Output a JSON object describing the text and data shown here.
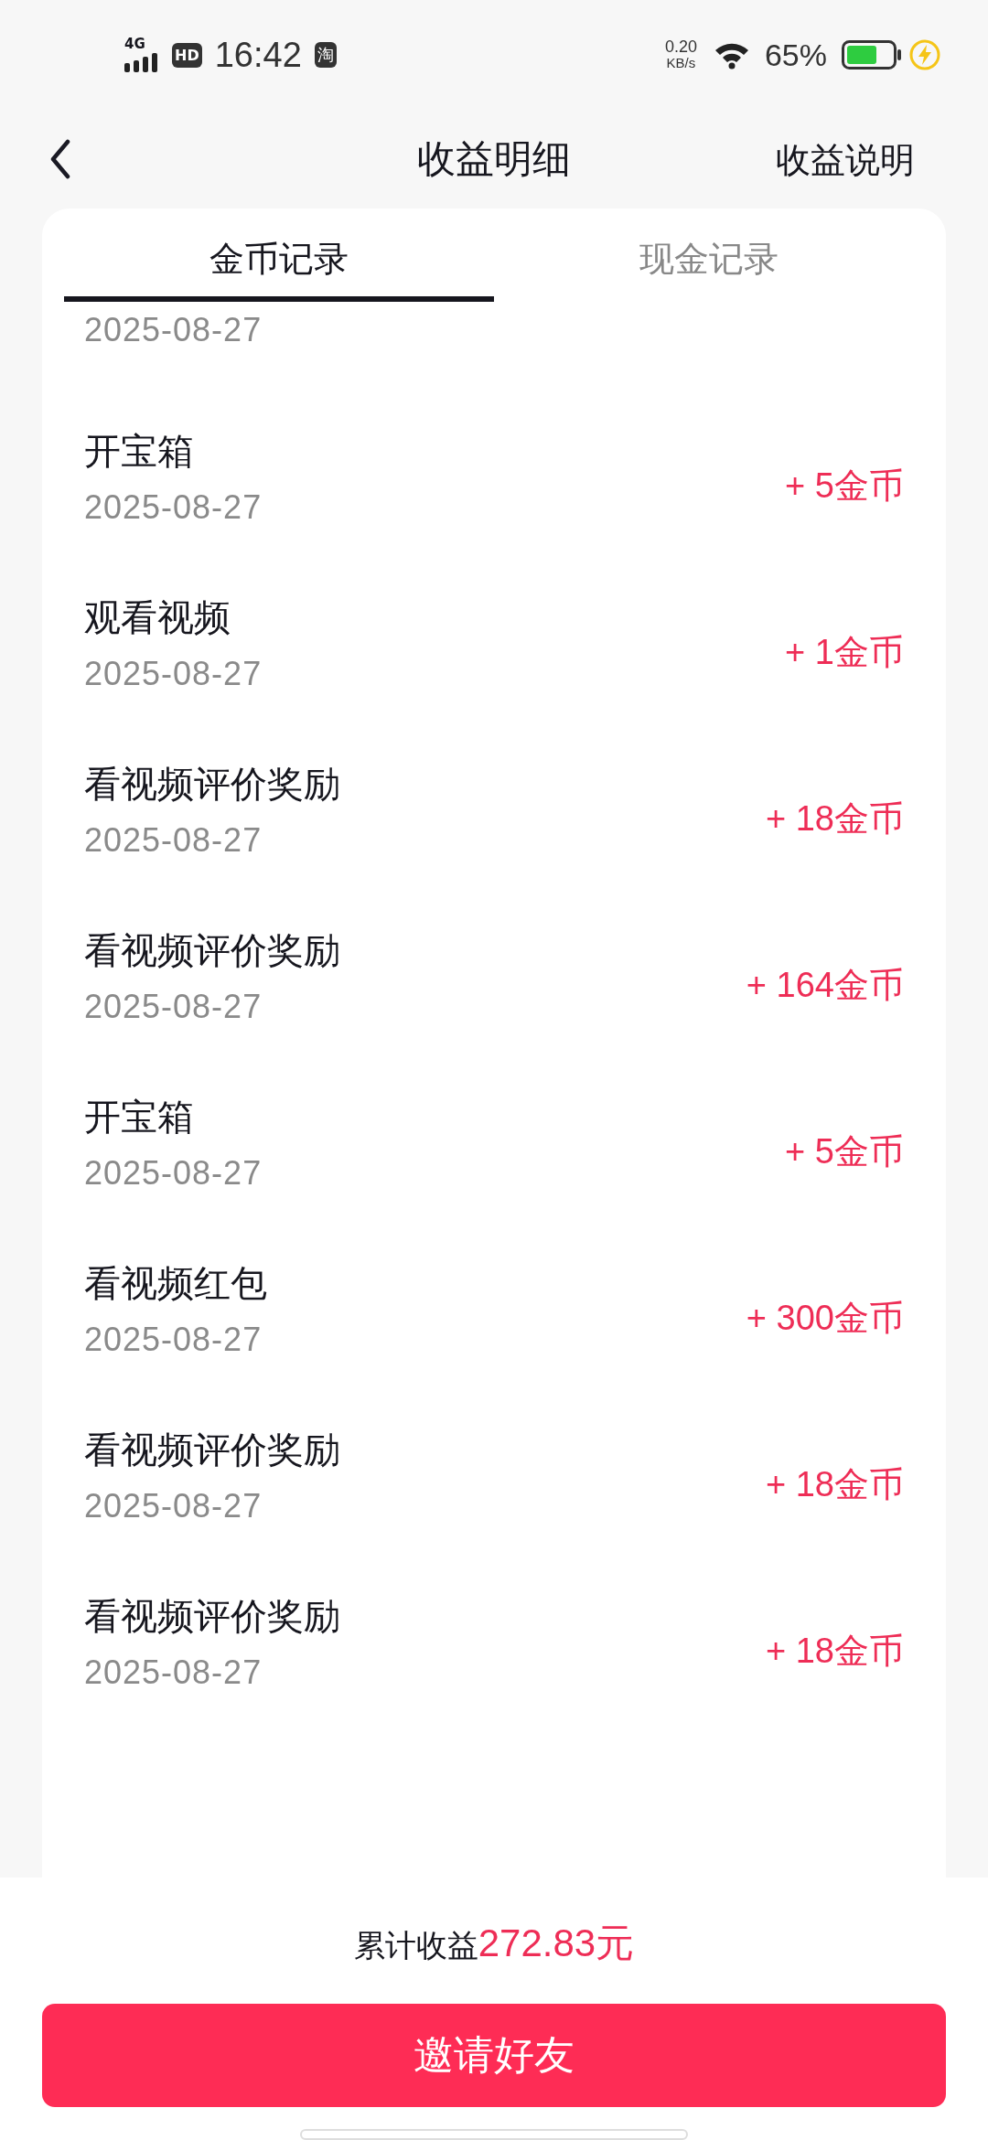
{
  "status_bar": {
    "network": "4G",
    "hd": "HD",
    "time": "16:42",
    "app_badge": "淘",
    "speed_value": "0.20",
    "speed_unit": "KB/s",
    "battery_percent": "65%"
  },
  "header": {
    "title": "收益明细",
    "action": "收益说明"
  },
  "tabs": [
    {
      "label": "金币记录",
      "selected": true
    },
    {
      "label": "现金记录",
      "selected": false
    }
  ],
  "partial_row": {
    "date": "2025-08-27"
  },
  "records": [
    {
      "name": "开宝箱",
      "date": "2025-08-27",
      "amount": "+ 5金币"
    },
    {
      "name": "观看视频",
      "date": "2025-08-27",
      "amount": "+ 1金币"
    },
    {
      "name": "看视频评价奖励",
      "date": "2025-08-27",
      "amount": "+ 18金币"
    },
    {
      "name": "看视频评价奖励",
      "date": "2025-08-27",
      "amount": "+ 164金币"
    },
    {
      "name": "开宝箱",
      "date": "2025-08-27",
      "amount": "+ 5金币"
    },
    {
      "name": "看视频红包",
      "date": "2025-08-27",
      "amount": "+ 300金币"
    },
    {
      "name": "看视频评价奖励",
      "date": "2025-08-27",
      "amount": "+ 18金币"
    },
    {
      "name": "看视频评价奖励",
      "date": "2025-08-27",
      "amount": "+ 18金币"
    }
  ],
  "footer": {
    "total_label": "累计收益",
    "total_value": "272.83元",
    "button": "邀请好友"
  }
}
